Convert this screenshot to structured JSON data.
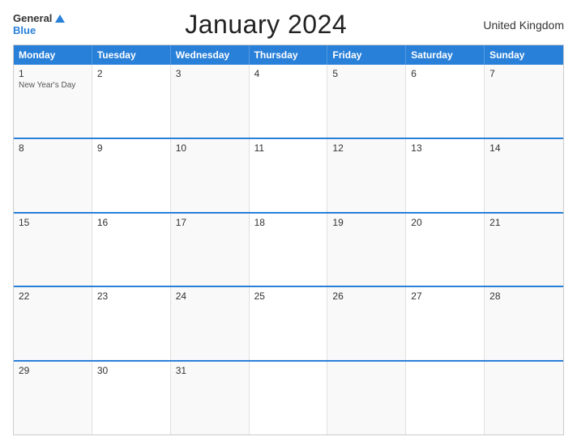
{
  "header": {
    "logo_general": "General",
    "logo_blue": "Blue",
    "title": "January 2024",
    "country": "United Kingdom"
  },
  "weekdays": [
    "Monday",
    "Tuesday",
    "Wednesday",
    "Thursday",
    "Friday",
    "Saturday",
    "Sunday"
  ],
  "weeks": [
    [
      {
        "day": "1",
        "event": "New Year's Day"
      },
      {
        "day": "2",
        "event": ""
      },
      {
        "day": "3",
        "event": ""
      },
      {
        "day": "4",
        "event": ""
      },
      {
        "day": "5",
        "event": ""
      },
      {
        "day": "6",
        "event": ""
      },
      {
        "day": "7",
        "event": ""
      }
    ],
    [
      {
        "day": "8",
        "event": ""
      },
      {
        "day": "9",
        "event": ""
      },
      {
        "day": "10",
        "event": ""
      },
      {
        "day": "11",
        "event": ""
      },
      {
        "day": "12",
        "event": ""
      },
      {
        "day": "13",
        "event": ""
      },
      {
        "day": "14",
        "event": ""
      }
    ],
    [
      {
        "day": "15",
        "event": ""
      },
      {
        "day": "16",
        "event": ""
      },
      {
        "day": "17",
        "event": ""
      },
      {
        "day": "18",
        "event": ""
      },
      {
        "day": "19",
        "event": ""
      },
      {
        "day": "20",
        "event": ""
      },
      {
        "day": "21",
        "event": ""
      }
    ],
    [
      {
        "day": "22",
        "event": ""
      },
      {
        "day": "23",
        "event": ""
      },
      {
        "day": "24",
        "event": ""
      },
      {
        "day": "25",
        "event": ""
      },
      {
        "day": "26",
        "event": ""
      },
      {
        "day": "27",
        "event": ""
      },
      {
        "day": "28",
        "event": ""
      }
    ],
    [
      {
        "day": "29",
        "event": ""
      },
      {
        "day": "30",
        "event": ""
      },
      {
        "day": "31",
        "event": ""
      },
      {
        "day": "",
        "event": ""
      },
      {
        "day": "",
        "event": ""
      },
      {
        "day": "",
        "event": ""
      },
      {
        "day": "",
        "event": ""
      }
    ]
  ]
}
